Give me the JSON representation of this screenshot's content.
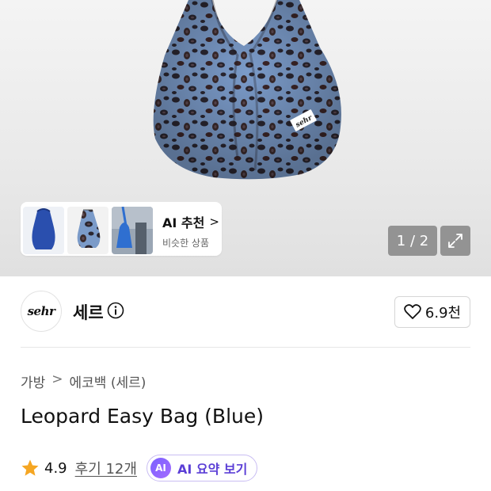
{
  "hero": {
    "bag_label": "sehr",
    "ai_recommend": {
      "title": "AI 추천",
      "chevron": ">",
      "subtitle": "비슷한 상품",
      "thumbnails": [
        "blue-bag-thumb",
        "leopard-bag-thumb",
        "model-blue-bag-thumb"
      ]
    },
    "pager": "1 / 2",
    "expand_icon": "expand-icon"
  },
  "brand": {
    "logo_text": "sehr",
    "name": "세르",
    "info_icon": "info-icon",
    "like_icon": "heart-icon",
    "like_count": "6.9천"
  },
  "product": {
    "breadcrumb": [
      "가방",
      "에코백 (세르)"
    ],
    "breadcrumb_separator": ">",
    "title": "Leopard Easy Bag (Blue)",
    "rating": "4.9",
    "reviews": "후기 12개",
    "ai_badge": "AI",
    "ai_summary_label": "AI 요약 보기"
  },
  "colors": {
    "bag_base": "#7b9bc9",
    "bag_spots": "#2a2630",
    "star": "#f5a623",
    "ai_accent": "#7b61ff"
  }
}
